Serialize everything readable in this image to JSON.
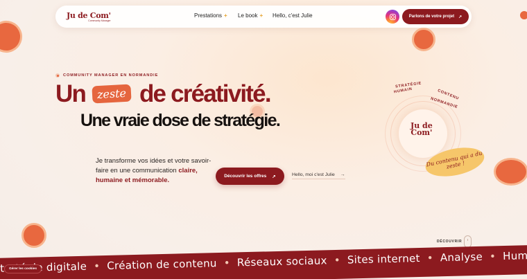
{
  "brand": {
    "logo_text": "Ju de Com'",
    "logo_subtitle": "Community Manager"
  },
  "nav": {
    "items": [
      {
        "label": "Prestations",
        "plus": "+"
      },
      {
        "label": "Le book",
        "plus": "+"
      },
      {
        "label": "Hello, c'est Julie"
      }
    ],
    "cta_label": "Parlons de votre projet",
    "cta_arrow": "↗"
  },
  "hero": {
    "eyebrow": "COMMUNITY MANAGER EN NORMANDIE",
    "title_part1": "Un",
    "title_highlight": "zeste",
    "title_part2": "de créativité.",
    "subtitle": "Une vraie dose de stratégie.",
    "intro_text": "Je transforme vos idées et votre savoir-faire en une communication",
    "intro_bold": "claire, humaine et mémorable.",
    "cta_primary": "Découvrir les offres",
    "cta_primary_arrow": "↗",
    "cta_secondary": "Hello, moi c'est Julie",
    "cta_secondary_arrow": "→"
  },
  "badge": {
    "words": [
      "STRATÉGIE",
      "CONTENU",
      "NORMANDIE",
      "HUMAIN"
    ],
    "logo_line1": "Ju de",
    "logo_line2": "Com'",
    "sticker_text": "Du contenu qui a du zeste !"
  },
  "scroll": {
    "label": "DÉCOUVRIR"
  },
  "marquee": {
    "items": [
      "Stratégie digitale",
      "Création de contenu",
      "Réseaux sociaux",
      "Sites internet",
      "Analyse",
      "Humain"
    ],
    "separator": "•"
  },
  "cookies": {
    "label": "Gérer les cookies"
  },
  "colors": {
    "brand": "#8c1a1f",
    "accent": "#e5653e",
    "sticker": "#f6c66a"
  }
}
